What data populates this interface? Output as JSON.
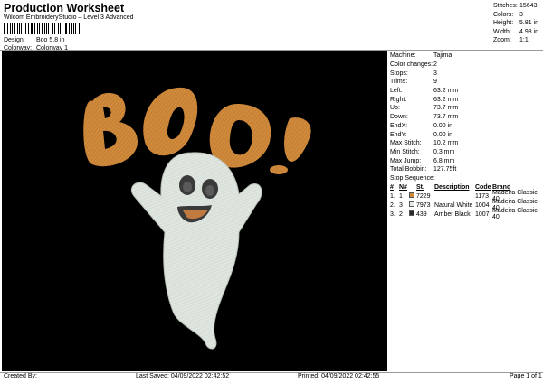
{
  "header": {
    "title": "Production Worksheet",
    "subtitle": "Wilcom EmbroideryStudio – Level 3 Advanced",
    "design_label": "Design:",
    "design_value": "Boo 5,8 in",
    "colorway_label": "Colorway:",
    "colorway_value": "Colorway 1"
  },
  "summary": [
    {
      "k": "Stitches:",
      "v": "15643"
    },
    {
      "k": "Colors:",
      "v": "3"
    },
    {
      "k": "Height:",
      "v": "5.81 in"
    },
    {
      "k": "Width:",
      "v": "4.98 in"
    },
    {
      "k": "Zoom:",
      "v": "1:1"
    }
  ],
  "details": [
    {
      "k": "Machine:",
      "v": "Tajima"
    },
    {
      "k": "Color changes:",
      "v": "2"
    },
    {
      "k": "Stops:",
      "v": "3"
    },
    {
      "k": "Trims:",
      "v": "9"
    },
    {
      "k": "Left:",
      "v": "63.2 mm"
    },
    {
      "k": "Right:",
      "v": "63.2 mm"
    },
    {
      "k": "Up:",
      "v": "73.7 mm"
    },
    {
      "k": "Down:",
      "v": "73.7 mm"
    },
    {
      "k": "EndX:",
      "v": "0.00 in"
    },
    {
      "k": "EndY:",
      "v": "0.00 in"
    },
    {
      "k": "Max Stitch:",
      "v": "10.2 mm"
    },
    {
      "k": "Min Stitch:",
      "v": "0.3 mm"
    },
    {
      "k": "Max Jump:",
      "v": "6.8 mm"
    },
    {
      "k": "Total Bobbin:",
      "v": "127.75ft"
    }
  ],
  "stop_sequence": {
    "title": "Stop Sequence:",
    "headers": {
      "num": "#",
      "n": "N#",
      "st": "St.",
      "desc": "Description",
      "code": "Code",
      "brand": "Brand"
    },
    "rows": [
      {
        "num": "1.",
        "n": "1",
        "color": "#d08a3c",
        "st": "7229",
        "desc": "",
        "code": "1173",
        "brand": "Madeira Classic 40"
      },
      {
        "num": "2.",
        "n": "3",
        "color": "#e6ece6",
        "st": "7973",
        "desc": "Natural White",
        "code": "1004",
        "brand": "Madeira Classic 40"
      },
      {
        "num": "3.",
        "n": "2",
        "color": "#2a2a2a",
        "st": "439",
        "desc": "Amber Black",
        "code": "1007",
        "brand": "Madeira Classic 40"
      }
    ]
  },
  "footer": {
    "created_by": "Created By:",
    "last_saved": "Last Saved: 04/09/2022 02:42:52",
    "printed": "Printed: 04/09/2022 02:42:55",
    "page": "Page 1 of 1"
  },
  "colors": {
    "orange": "#d08a3c",
    "ghost": "#dfe6df",
    "black": "#000000"
  }
}
